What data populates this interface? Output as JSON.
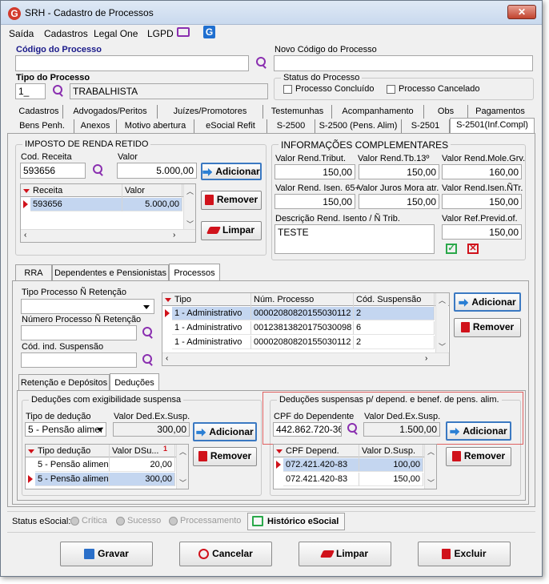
{
  "window": {
    "app_logo": "G",
    "title": "SRH - Cadastro de Processos",
    "close": "✕"
  },
  "menu": [
    "Saída",
    "Cadastros",
    "Legal One",
    "LGPD"
  ],
  "header": {
    "codigo_label": "Código do Processo",
    "codigo_value": "",
    "novo_codigo_label": "Novo Código do Processo",
    "novo_codigo_value": "",
    "tipo_label": "Tipo do Processo",
    "tipo_code": "1_",
    "tipo_desc": "TRABALHISTA",
    "status_label": "Status do Processo",
    "concluido": "Processo Concluído",
    "cancelado": "Processo Cancelado"
  },
  "tabs_row1": [
    "Cadastros",
    "Advogados/Peritos",
    "Juízes/Promotores",
    "Testemunhas",
    "Acompanhamento",
    "Obs",
    "Pagamentos"
  ],
  "tabs_row2": [
    "Bens Penh.",
    "Anexos",
    "Motivo abertura",
    "eSocial Refit",
    "S-2500",
    "S-2500 (Pens. Alim)",
    "S-2501",
    "S-2501(Inf.Compl)"
  ],
  "irrf": {
    "title": "IMPOSTO DE RENDA RETIDO",
    "cod_label": "Cod. Receita",
    "cod_value": "593656",
    "valor_label": "Valor",
    "valor_value": "5.000,00",
    "col_receita": "Receita",
    "col_valor": "Valor",
    "rows": [
      {
        "receita": "593656",
        "valor": "5.000,00"
      }
    ]
  },
  "buttons": {
    "adicionar": "Adicionar",
    "remover": "Remover",
    "limpar": "Limpar"
  },
  "info": {
    "title": "INFORMAÇÕES COMPLEMENTARES",
    "fields": [
      {
        "label": "Valor Rend.Tribut.",
        "value": "150,00"
      },
      {
        "label": "Valor Rend.Tb.13º",
        "value": "150,00"
      },
      {
        "label": "Valor Rend.Mole.Grv.",
        "value": "160,00"
      },
      {
        "label": "Valor Rend. Isen. 65+",
        "value": "150,00"
      },
      {
        "label": "Valor Juros Mora atr.",
        "value": "150,00"
      },
      {
        "label": "Valor Rend.Isen.ÑTr.",
        "value": "150,00"
      }
    ],
    "desc_label": "Descrição Rend. Isento / Ñ Trib.",
    "desc_value": "TESTE",
    "ref_label": "Valor Ref.Previd.of.",
    "ref_value": "150,00"
  },
  "subtabs": [
    "RRA",
    "Dependentes e Pensionistas",
    "Processos"
  ],
  "processos": {
    "tipo_label": "Tipo Processo Ñ Retenção",
    "num_label": "Número Processo Ñ Retenção",
    "cod_label": "Cód. ind. Suspensão",
    "col_tipo": "Tipo",
    "col_num": "Núm. Processo",
    "col_cod": "Cód. Suspensão",
    "rows": [
      {
        "tipo": "1 - Administrativo",
        "num": "00002080820155030112",
        "cod": "2"
      },
      {
        "tipo": "1 - Administrativo",
        "num": "00123813820175030098",
        "cod": "6"
      },
      {
        "tipo": "1 - Administrativo",
        "num": "00002080820155030112",
        "cod": "2"
      }
    ]
  },
  "subtabs2": [
    "Retenção e Depósitos",
    "Deduções"
  ],
  "deducoes": {
    "title": "Deduções com exigibilidade suspensa",
    "tipo_label": "Tipo de dedução",
    "tipo_value": "5 - Pensão alimer",
    "valor_label": "Valor Ded.Ex.Susp.",
    "valor_value": "300,00",
    "col_tipo": "Tipo dedução",
    "col_valor": "Valor DSu...",
    "sort_badge": "1",
    "rows": [
      {
        "tipo": "5 - Pensão alimen...",
        "valor": "20,00"
      },
      {
        "tipo": "5 - Pensão alimen...",
        "valor": "300,00"
      }
    ]
  },
  "dep_deducoes": {
    "title": "Deduções suspensas p/ depend. e benef. de pens. alim.",
    "cpf_label": "CPF do Dependente",
    "cpf_value": "442.862.720-36",
    "valor_label": "Valor Ded.Ex.Susp.",
    "valor_value": "1.500,00",
    "col_cpf": "CPF Depend.",
    "col_valor": "Valor D.Susp.",
    "rows": [
      {
        "cpf": "072.421.420-83",
        "valor": "100,00"
      },
      {
        "cpf": "072.421.420-83",
        "valor": "150,00"
      }
    ]
  },
  "status_esocial": {
    "label": "Status eSocial:",
    "critica": "Crítica",
    "sucesso": "Sucesso",
    "processamento": "Processamento",
    "historico": "Histórico eSocial"
  },
  "footer": {
    "gravar": "Gravar",
    "cancelar": "Cancelar",
    "limpar": "Limpar",
    "excluir": "Excluir"
  },
  "colors": {
    "accent_red": "#d0121b",
    "select_blue": "#c4d6f0",
    "highlight_box": "#e06060"
  }
}
